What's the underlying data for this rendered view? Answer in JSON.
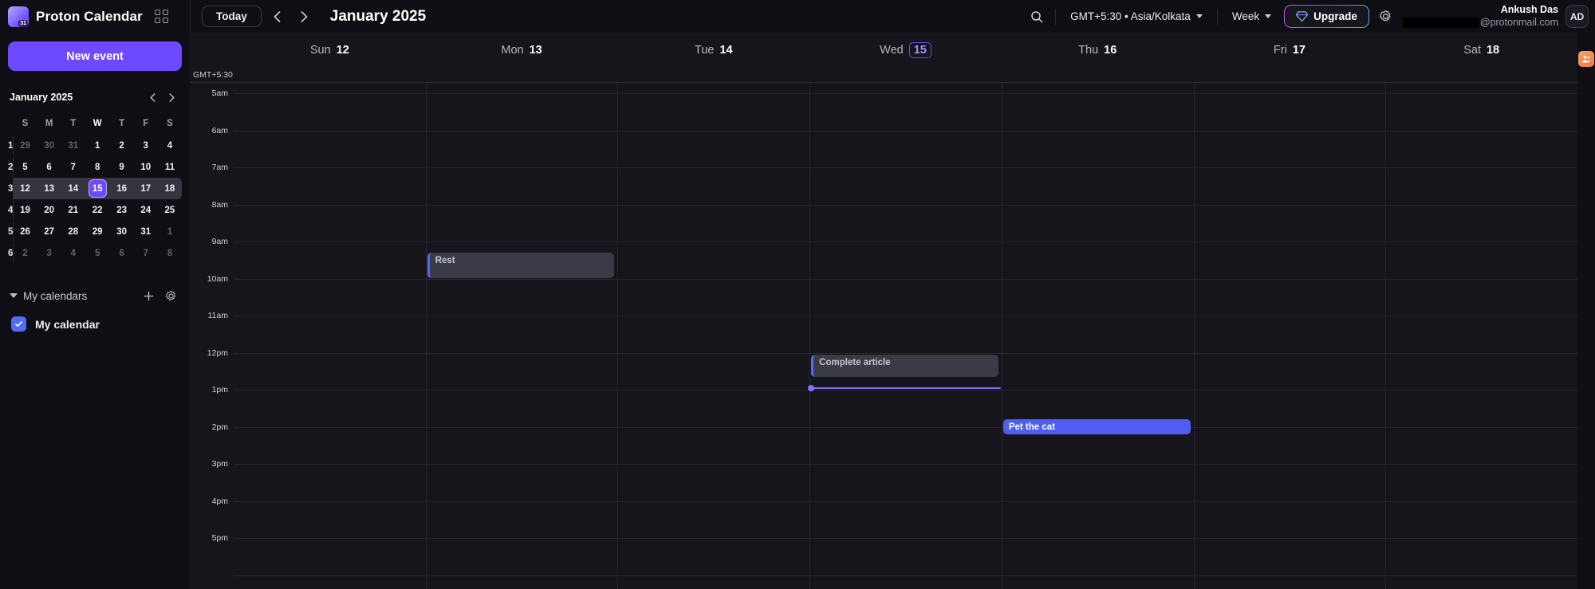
{
  "app": {
    "brand_name": "Proton Calendar",
    "logo_badge": "31",
    "app_switcher_icon": "apps-grid-icon"
  },
  "toolbar": {
    "today_label": "Today",
    "prev_icon": "chevron-left-icon",
    "next_icon": "chevron-right-icon",
    "view_title": "January 2025",
    "search_icon": "search-icon",
    "timezone_label": "GMT+5:30 • Asia/Kolkata",
    "view_label": "Week",
    "upgrade_label": "Upgrade",
    "upgrade_icon": "diamond-icon",
    "settings_icon": "gear-icon"
  },
  "account": {
    "name": "Ankush Das",
    "email_domain": "@protonmail.com",
    "avatar_initials": "AD"
  },
  "sidebar": {
    "new_event_label": "New event",
    "mini_calendar": {
      "title": "January 2025",
      "prev_icon": "chevron-left-icon",
      "next_icon": "chevron-right-icon",
      "weekday_headers": [
        "S",
        "M",
        "T",
        "W",
        "T",
        "F",
        "S"
      ],
      "weeks": [
        {
          "num": "1",
          "selected": false,
          "days": [
            {
              "n": "29",
              "out": true
            },
            {
              "n": "30",
              "out": true
            },
            {
              "n": "31",
              "out": true
            },
            {
              "n": "1",
              "out": false
            },
            {
              "n": "2",
              "out": false
            },
            {
              "n": "3",
              "out": false
            },
            {
              "n": "4",
              "out": false
            }
          ]
        },
        {
          "num": "2",
          "selected": false,
          "days": [
            {
              "n": "5",
              "out": false
            },
            {
              "n": "6",
              "out": false
            },
            {
              "n": "7",
              "out": false
            },
            {
              "n": "8",
              "out": false
            },
            {
              "n": "9",
              "out": false
            },
            {
              "n": "10",
              "out": false
            },
            {
              "n": "11",
              "out": false
            }
          ]
        },
        {
          "num": "3",
          "selected": true,
          "days": [
            {
              "n": "12",
              "out": false
            },
            {
              "n": "13",
              "out": false
            },
            {
              "n": "14",
              "out": false
            },
            {
              "n": "15",
              "out": false,
              "today": true
            },
            {
              "n": "16",
              "out": false
            },
            {
              "n": "17",
              "out": false
            },
            {
              "n": "18",
              "out": false
            }
          ]
        },
        {
          "num": "4",
          "selected": false,
          "days": [
            {
              "n": "19",
              "out": false
            },
            {
              "n": "20",
              "out": false
            },
            {
              "n": "21",
              "out": false
            },
            {
              "n": "22",
              "out": false
            },
            {
              "n": "23",
              "out": false
            },
            {
              "n": "24",
              "out": false
            },
            {
              "n": "25",
              "out": false
            }
          ]
        },
        {
          "num": "5",
          "selected": false,
          "days": [
            {
              "n": "26",
              "out": false
            },
            {
              "n": "27",
              "out": false
            },
            {
              "n": "28",
              "out": false
            },
            {
              "n": "29",
              "out": false
            },
            {
              "n": "30",
              "out": false
            },
            {
              "n": "31",
              "out": false
            },
            {
              "n": "1",
              "out": true
            }
          ]
        },
        {
          "num": "6",
          "selected": false,
          "days": [
            {
              "n": "2",
              "out": true
            },
            {
              "n": "3",
              "out": true
            },
            {
              "n": "4",
              "out": true
            },
            {
              "n": "5",
              "out": true
            },
            {
              "n": "6",
              "out": true
            },
            {
              "n": "7",
              "out": true
            },
            {
              "n": "8",
              "out": true
            }
          ]
        }
      ]
    },
    "calendars": {
      "section_label": "My calendars",
      "collapse_icon": "chevron-down-icon",
      "add_icon": "plus-icon",
      "settings_icon": "gear-icon",
      "items": [
        {
          "label": "My calendar",
          "checked": true,
          "color": "#4f6df5"
        }
      ]
    }
  },
  "calendar": {
    "timezone_label": "GMT+5:30",
    "days": [
      {
        "dow": "Sun",
        "num": "12",
        "selected": false
      },
      {
        "dow": "Mon",
        "num": "13",
        "selected": false
      },
      {
        "dow": "Tue",
        "num": "14",
        "selected": false
      },
      {
        "dow": "Wed",
        "num": "15",
        "selected": true
      },
      {
        "dow": "Thu",
        "num": "16",
        "selected": false
      },
      {
        "dow": "Fri",
        "num": "17",
        "selected": false
      },
      {
        "dow": "Sat",
        "num": "18",
        "selected": false
      }
    ],
    "hours": [
      "5am",
      "6am",
      "7am",
      "8am",
      "9am",
      "10am",
      "11am",
      "12pm",
      "1pm",
      "2pm",
      "3pm",
      "4pm",
      "5pm"
    ],
    "events": [
      {
        "title": "Rest",
        "day_index": 1,
        "start_hour": 9.3,
        "end_hour": 10.0,
        "style": "past",
        "accent": "#4f6df5"
      },
      {
        "title": "Complete article",
        "day_index": 3,
        "start_hour": 12.05,
        "end_hour": 12.65,
        "style": "past",
        "accent": "#4f6df5"
      },
      {
        "title": "Pet the cat",
        "day_index": 4,
        "start_hour": 13.8,
        "end_hour": 14.2,
        "style": "solid",
        "accent": "#4f5ef0"
      }
    ],
    "now_indicator": {
      "day_index": 3,
      "hour": 12.93,
      "color": "#8b6dff"
    }
  },
  "right_rail": {
    "contacts_icon": "contacts-icon"
  }
}
